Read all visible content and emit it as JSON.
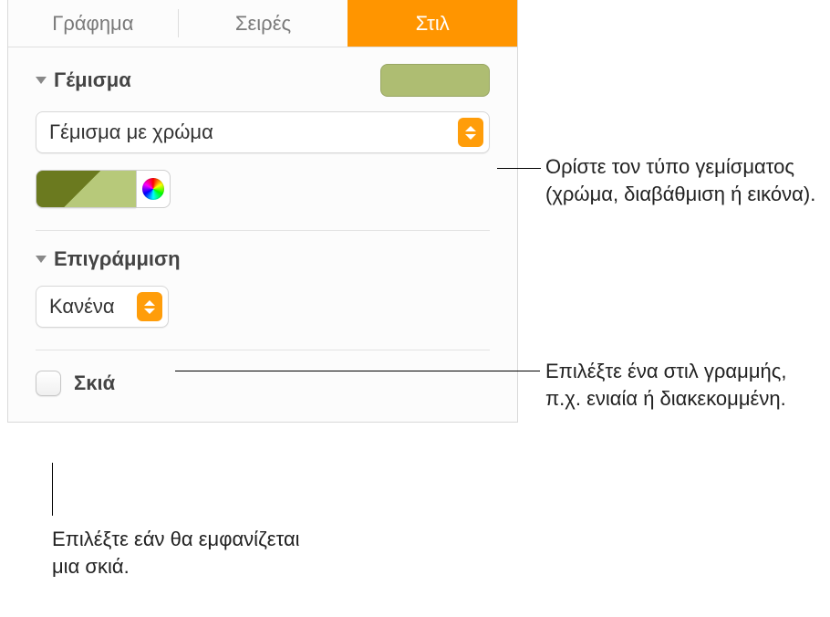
{
  "tabs": {
    "chart": "Γράφημα",
    "series": "Σειρές",
    "style": "Στιλ"
  },
  "fill": {
    "title": "Γέμισμα",
    "typeSelected": "Γέμισμα με χρώμα"
  },
  "stroke": {
    "title": "Επιγράμμιση",
    "selected": "Κανένα"
  },
  "shadow": {
    "label": "Σκιά"
  },
  "callouts": {
    "fill": "Ορίστε τον τύπο γεμίσματος (χρώμα, διαβάθμιση ή εικόνα).",
    "stroke": "Επιλέξτε ένα στιλ γραμμής, π.χ. ενιαία ή διακεκομμένη.",
    "shadow": "Επιλέξτε εάν θα εμφανίζεται μια σκιά."
  }
}
